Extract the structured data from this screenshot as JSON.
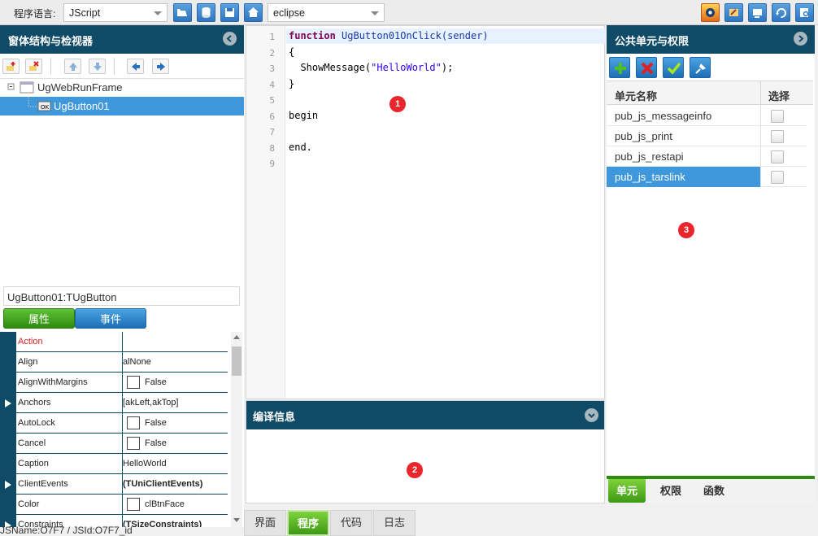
{
  "toolbar": {
    "language_label": "程序语言:",
    "language_value": "JScript",
    "theme_value": "eclipse",
    "icons": [
      "open-icon",
      "database-icon",
      "save-icon",
      "home-icon"
    ],
    "right_icons": [
      "settings-icon",
      "edit-icon",
      "window-icon",
      "refresh-icon",
      "preview-icon"
    ]
  },
  "left_panel": {
    "title": "窗体结构与检视器",
    "tree": [
      {
        "label": "UgWebRunFrame",
        "selected": false
      },
      {
        "label": "UgButton01",
        "selected": true
      }
    ],
    "object_name": "UgButton01:TUgButton",
    "tabs": [
      "属性",
      "事件"
    ],
    "properties": [
      {
        "name": "Action",
        "value": "",
        "checkbox": false
      },
      {
        "name": "Align",
        "value": "alNone",
        "checkbox": false
      },
      {
        "name": "AlignWithMargins",
        "value": "False",
        "checkbox": true
      },
      {
        "name": "Anchors",
        "value": "[akLeft,akTop]",
        "checkbox": false
      },
      {
        "name": "AutoLock",
        "value": "False",
        "checkbox": true
      },
      {
        "name": "Cancel",
        "value": "False",
        "checkbox": true
      },
      {
        "name": "Caption",
        "value": "HelloWorld",
        "checkbox": false
      },
      {
        "name": "ClientEvents",
        "value": "(TUniClientEvents)",
        "checkbox": false
      },
      {
        "name": "Color",
        "value": "clBtnFace",
        "checkbox": true
      },
      {
        "name": "Constraints",
        "value": "(TSizeConstraints)",
        "checkbox": false
      }
    ]
  },
  "editor": {
    "line_numbers": [
      "1",
      "2",
      "3",
      "4",
      "5",
      "6",
      "7",
      "8",
      "9"
    ],
    "lines": [
      {
        "kw": "function",
        "fn": " UgButton01OnClick(sender)",
        "rest": ""
      },
      {
        "kw": "",
        "fn": "",
        "rest": "{"
      },
      {
        "kw": "",
        "fn": "",
        "rest": "  ShowMessage(\"HelloWorld\");"
      },
      {
        "kw": "",
        "fn": "",
        "rest": "}"
      },
      {
        "kw": "",
        "fn": "",
        "rest": ""
      },
      {
        "kw": "",
        "fn": "",
        "rest": "begin"
      },
      {
        "kw": "",
        "fn": "",
        "rest": ""
      },
      {
        "kw": "",
        "fn": "",
        "rest": "end."
      },
      {
        "kw": "",
        "fn": "",
        "rest": ""
      }
    ]
  },
  "compile_panel": {
    "title": "编译信息"
  },
  "markers": [
    "1",
    "2",
    "3"
  ],
  "bottom_tabs": [
    "界面",
    "程序",
    "代码",
    "日志"
  ],
  "status_text": "JSName:O7F7 / JSId:O7F7_id",
  "right_panel": {
    "title": "公共单元与权限",
    "columns": [
      "单元名称",
      "选择"
    ],
    "units": [
      {
        "name": "pub_js_messageinfo",
        "selected": false
      },
      {
        "name": "pub_js_print",
        "selected": false
      },
      {
        "name": "pub_js_restapi",
        "selected": false
      },
      {
        "name": "pub_js_tarslink",
        "selected": true
      }
    ],
    "tabs": [
      "单元",
      "权限",
      "函数"
    ]
  }
}
